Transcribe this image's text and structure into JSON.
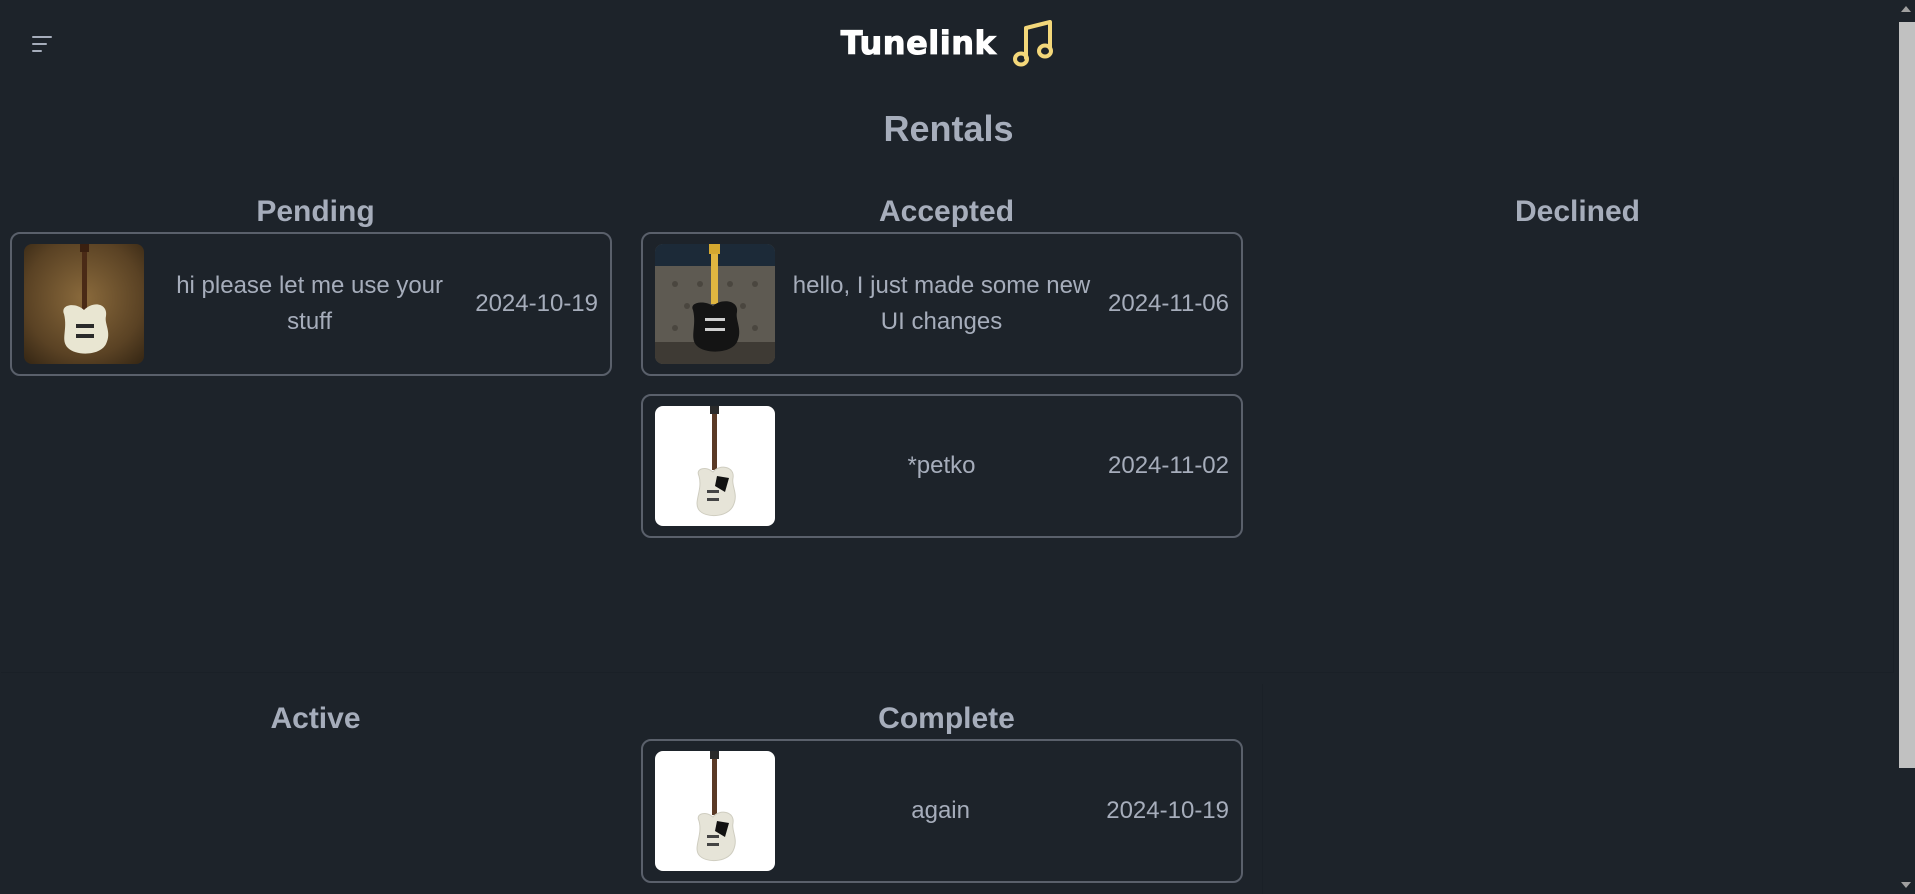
{
  "header": {
    "brand": "Tunelink",
    "menu_icon": "hamburger-menu-icon",
    "brand_icon": "music-note-icon",
    "brand_icon_color": "#f3d77a"
  },
  "page": {
    "title": "Rentals"
  },
  "sections": {
    "pending": {
      "title": "Pending",
      "items": [
        {
          "message": "hi please let me use your stuff",
          "date": "2024-10-19",
          "image": "guitar-photo-cream-offset-brown-backdrop"
        }
      ]
    },
    "accepted": {
      "title": "Accepted",
      "items": [
        {
          "message": "hello, I just made some new UI changes",
          "date": "2024-11-06",
          "image": "guitar-photo-black-strat-gray-chair"
        },
        {
          "message": "*petko",
          "date": "2024-11-02",
          "image": "guitar-photo-white-electric-white-backdrop"
        }
      ]
    },
    "declined": {
      "title": "Declined",
      "items": []
    },
    "active": {
      "title": "Active",
      "items": []
    },
    "complete": {
      "title": "Complete",
      "items": [
        {
          "message": "again",
          "date": "2024-10-19",
          "image": "guitar-photo-white-electric-white-backdrop"
        }
      ]
    }
  },
  "colors": {
    "background": "#1d232a",
    "text": "#a6adbb",
    "card_border": "#5a606b"
  }
}
